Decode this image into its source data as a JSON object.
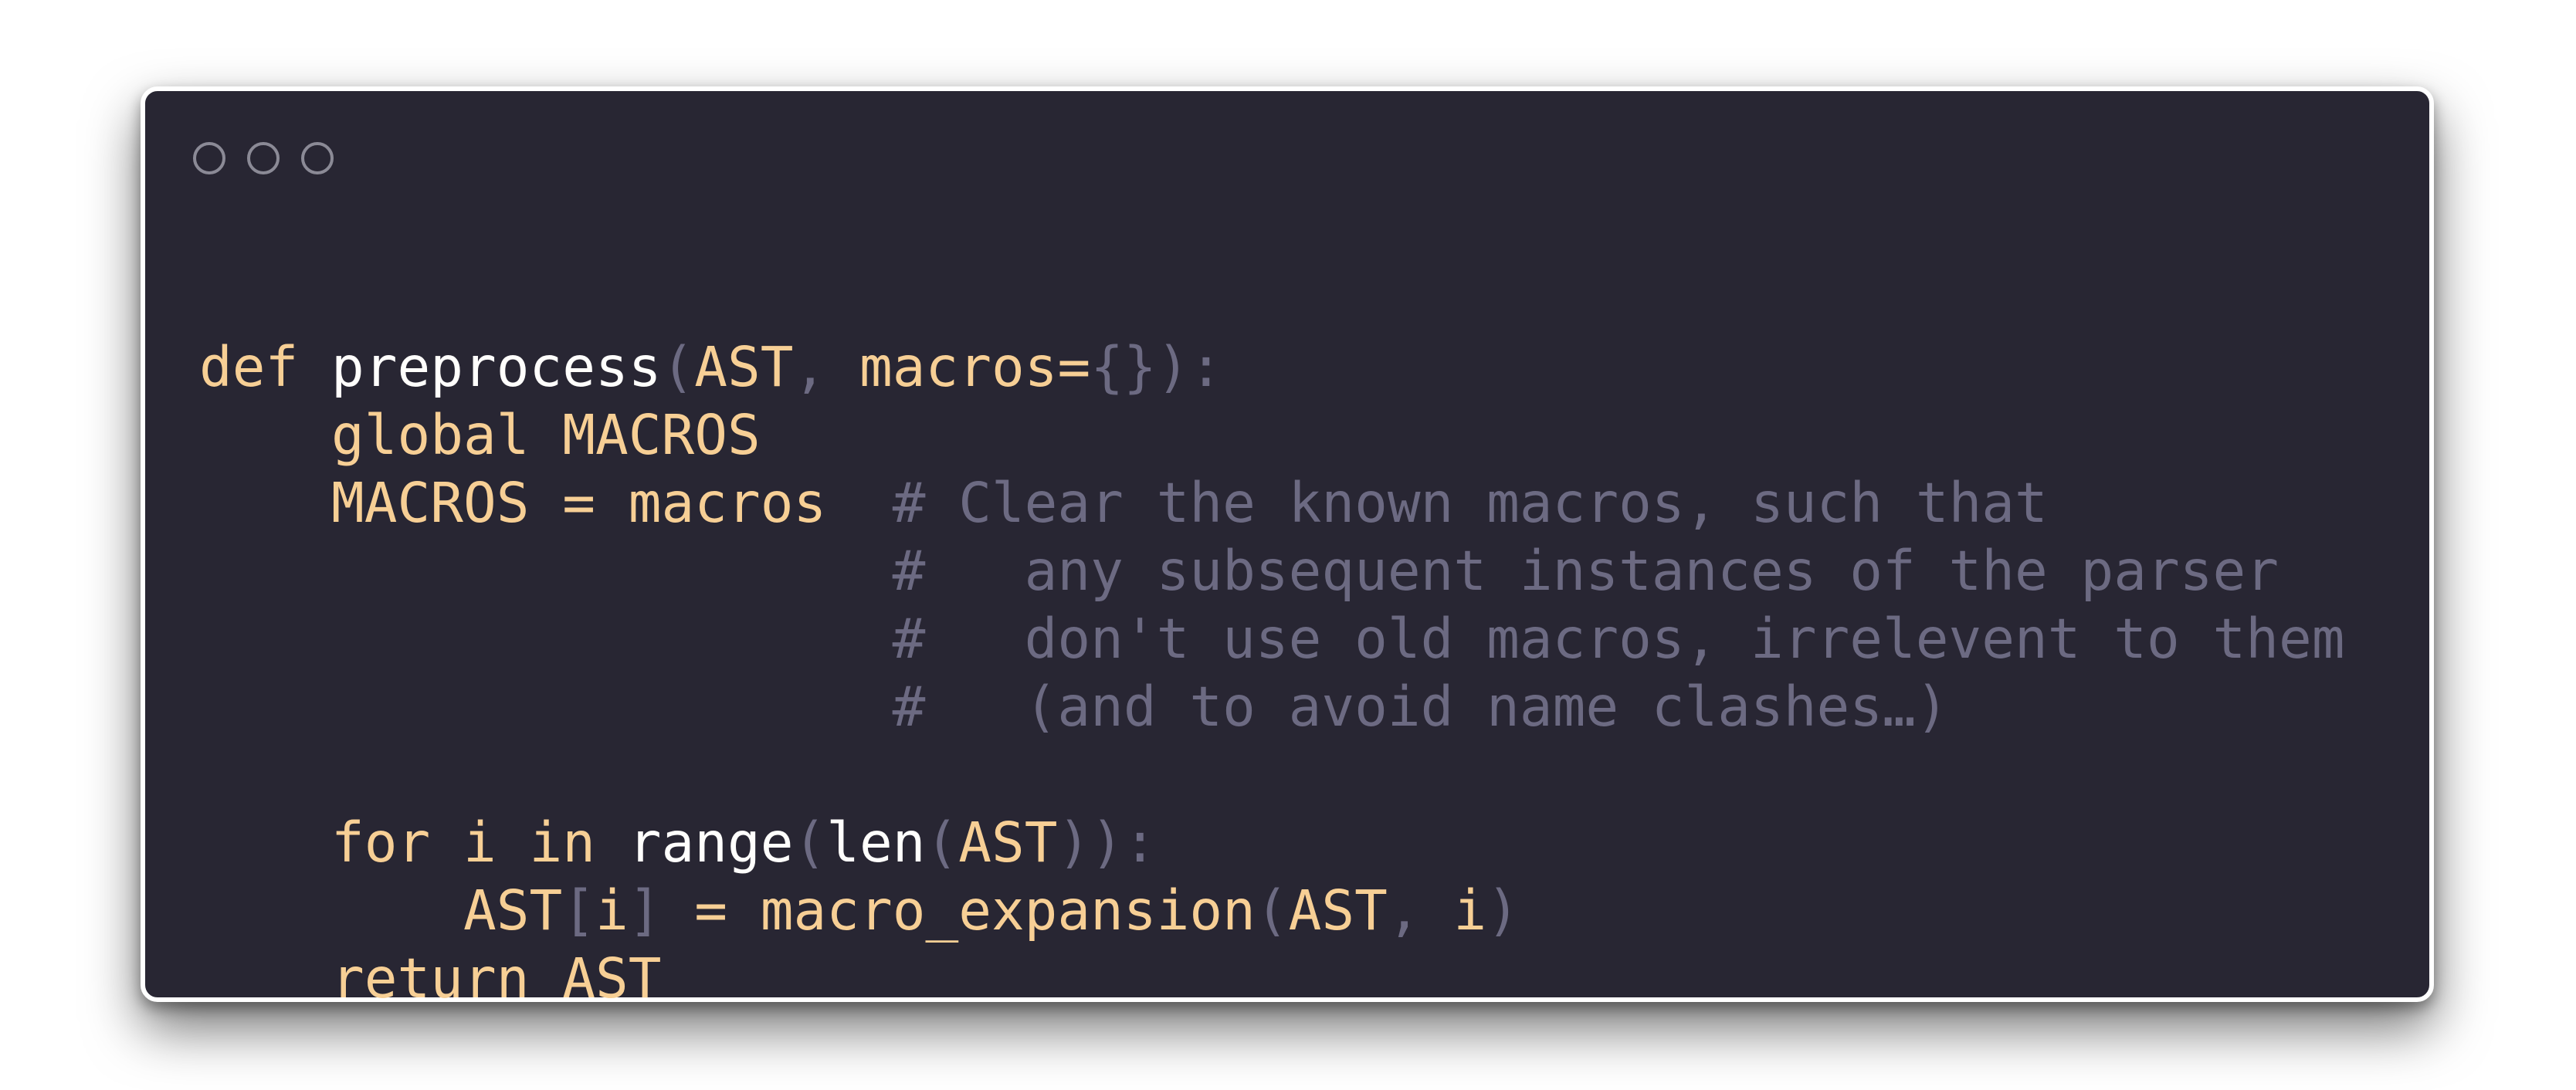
{
  "window": {
    "controls": [
      "close",
      "minimize",
      "maximize"
    ]
  },
  "colors": {
    "background": "#282633",
    "keyword": "#f7cf95",
    "name": "#fffefc",
    "punctuation": "#6c6a82",
    "comment": "#6c6a82"
  },
  "code": {
    "language": "python",
    "lines": [
      [
        {
          "t": "def",
          "k": "keyword"
        },
        {
          "t": " ",
          "k": "plain"
        },
        {
          "t": "preprocess",
          "k": "name"
        },
        {
          "t": "(",
          "k": "punct"
        },
        {
          "t": "AST",
          "k": "id"
        },
        {
          "t": ", ",
          "k": "punct"
        },
        {
          "t": "macros",
          "k": "id"
        },
        {
          "t": "=",
          "k": "id"
        },
        {
          "t": "{}",
          "k": "punct"
        },
        {
          "t": "):",
          "k": "punct"
        }
      ],
      [
        {
          "t": "    ",
          "k": "plain"
        },
        {
          "t": "global",
          "k": "keyword"
        },
        {
          "t": " ",
          "k": "plain"
        },
        {
          "t": "MACROS",
          "k": "id"
        }
      ],
      [
        {
          "t": "    ",
          "k": "plain"
        },
        {
          "t": "MACROS",
          "k": "id"
        },
        {
          "t": " = ",
          "k": "id"
        },
        {
          "t": "macros",
          "k": "id"
        },
        {
          "t": "  ",
          "k": "plain"
        },
        {
          "t": "# Clear the known macros, such that",
          "k": "comment"
        }
      ],
      [
        {
          "t": "                     ",
          "k": "plain"
        },
        {
          "t": "#   any subsequent instances of the parser",
          "k": "comment"
        }
      ],
      [
        {
          "t": "                     ",
          "k": "plain"
        },
        {
          "t": "#   don't use old macros, irrelevent to them",
          "k": "comment"
        }
      ],
      [
        {
          "t": "                     ",
          "k": "plain"
        },
        {
          "t": "#   (and to avoid name clashes…)",
          "k": "comment"
        }
      ],
      [],
      [
        {
          "t": "    ",
          "k": "plain"
        },
        {
          "t": "for",
          "k": "keyword"
        },
        {
          "t": " ",
          "k": "plain"
        },
        {
          "t": "i",
          "k": "id"
        },
        {
          "t": " ",
          "k": "plain"
        },
        {
          "t": "in",
          "k": "keyword"
        },
        {
          "t": " ",
          "k": "plain"
        },
        {
          "t": "range",
          "k": "name"
        },
        {
          "t": "(",
          "k": "punct"
        },
        {
          "t": "len",
          "k": "name"
        },
        {
          "t": "(",
          "k": "punct"
        },
        {
          "t": "AST",
          "k": "id"
        },
        {
          "t": ")):",
          "k": "punct"
        }
      ],
      [
        {
          "t": "        ",
          "k": "plain"
        },
        {
          "t": "AST",
          "k": "id"
        },
        {
          "t": "[",
          "k": "punct"
        },
        {
          "t": "i",
          "k": "id"
        },
        {
          "t": "]",
          "k": "punct"
        },
        {
          "t": " = ",
          "k": "id"
        },
        {
          "t": "macro_expansion",
          "k": "id"
        },
        {
          "t": "(",
          "k": "punct"
        },
        {
          "t": "AST",
          "k": "id"
        },
        {
          "t": ", ",
          "k": "punct"
        },
        {
          "t": "i",
          "k": "id"
        },
        {
          "t": ")",
          "k": "punct"
        }
      ],
      [
        {
          "t": "    ",
          "k": "plain"
        },
        {
          "t": "return",
          "k": "keyword"
        },
        {
          "t": " ",
          "k": "plain"
        },
        {
          "t": "AST",
          "k": "id"
        }
      ]
    ]
  }
}
